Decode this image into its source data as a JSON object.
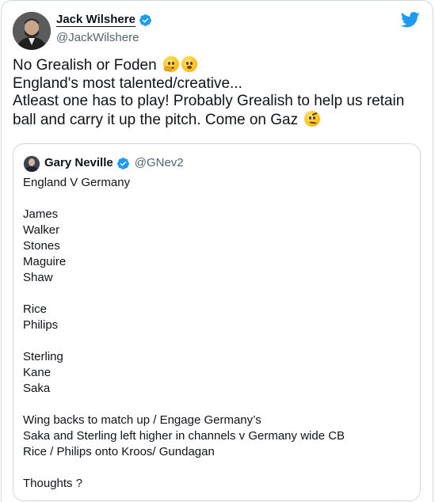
{
  "author": {
    "name": "Jack Wilshere",
    "handle": "@JackWilshere",
    "verified": true,
    "avatar_icon": "profile-photo"
  },
  "tweet": {
    "lines": [
      "No Grealish or Foden",
      "England's most talented/creative...",
      "Atleast one has to play! Probably Grealish to help us retain",
      "ball and carry it up the pitch. Come on Gaz"
    ],
    "emojis": [
      "thinking-face-emoji",
      "astonished-face-emoji",
      "raised-eyebrow-emoji"
    ]
  },
  "quoted_tweet": {
    "name": "Gary Neville",
    "handle": "@GNev2",
    "verified": true,
    "lines": [
      "England V Germany",
      "",
      "James",
      "Walker",
      "Stones",
      "Maguire",
      "Shaw",
      "",
      "Rice",
      "Philips",
      "",
      "Sterling",
      "Kane",
      "Saka",
      "",
      "Wing backs to match up / Engage Germany’s",
      "Saka and Sterling left higher in channels v Germany wide CB",
      "Rice / Philips onto Kroos/ Gundagan",
      "",
      "Thoughts ?"
    ]
  },
  "colors": {
    "twitter_blue": "#1d9bf0",
    "border": "#cfd9de",
    "secondary_text": "#536471",
    "primary_text": "#0f1419"
  },
  "icons": {
    "brand": "twitter-bird-icon",
    "verified": "verified-badge-icon"
  }
}
